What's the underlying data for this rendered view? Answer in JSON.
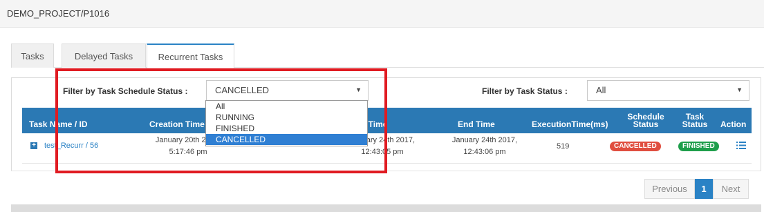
{
  "header": {
    "path": "DEMO_PROJECT/P1016"
  },
  "tabs": [
    {
      "label": "Tasks"
    },
    {
      "label": "Delayed Tasks"
    },
    {
      "label": "Recurrent Tasks"
    }
  ],
  "filters": {
    "schedule_label": "Filter by Task Schedule Status :",
    "schedule_value": "CANCELLED",
    "schedule_options": [
      "All",
      "RUNNING",
      "FINISHED",
      "CANCELLED"
    ],
    "task_label": "Filter by Task Status :",
    "task_value": "All"
  },
  "table": {
    "headers": {
      "name": "Task Name / ID",
      "creation": "Creation Time",
      "start": "Start Time",
      "end": "End Time",
      "exec": "ExecutionTime(ms)",
      "schedule_status_1": "Schedule",
      "schedule_status_2": "Status",
      "task_status_1": "Task",
      "task_status_2": "Status",
      "action": "Action"
    },
    "rows": [
      {
        "name": "test_Recurr / 56",
        "creation_1": "January 20th 2017,",
        "creation_2": "5:17:46 pm",
        "start_1": "January 24th 2017,",
        "start_2": "12:43:05 pm",
        "end_1": "January 24th 2017,",
        "end_2": "12:43:06 pm",
        "exec": "519",
        "schedule_status": "CANCELLED",
        "task_status": "FINISHED"
      }
    ]
  },
  "pagination": {
    "prev": "Previous",
    "current": "1",
    "next": "Next"
  },
  "colors": {
    "header_blue": "#2b79b4",
    "cancelled": "#e04e3f",
    "finished": "#1e9e4b",
    "highlight": "#e01b22"
  },
  "icons": {
    "expand": "plus-icon",
    "action": "list-icon",
    "caret": "caret-down-icon"
  }
}
